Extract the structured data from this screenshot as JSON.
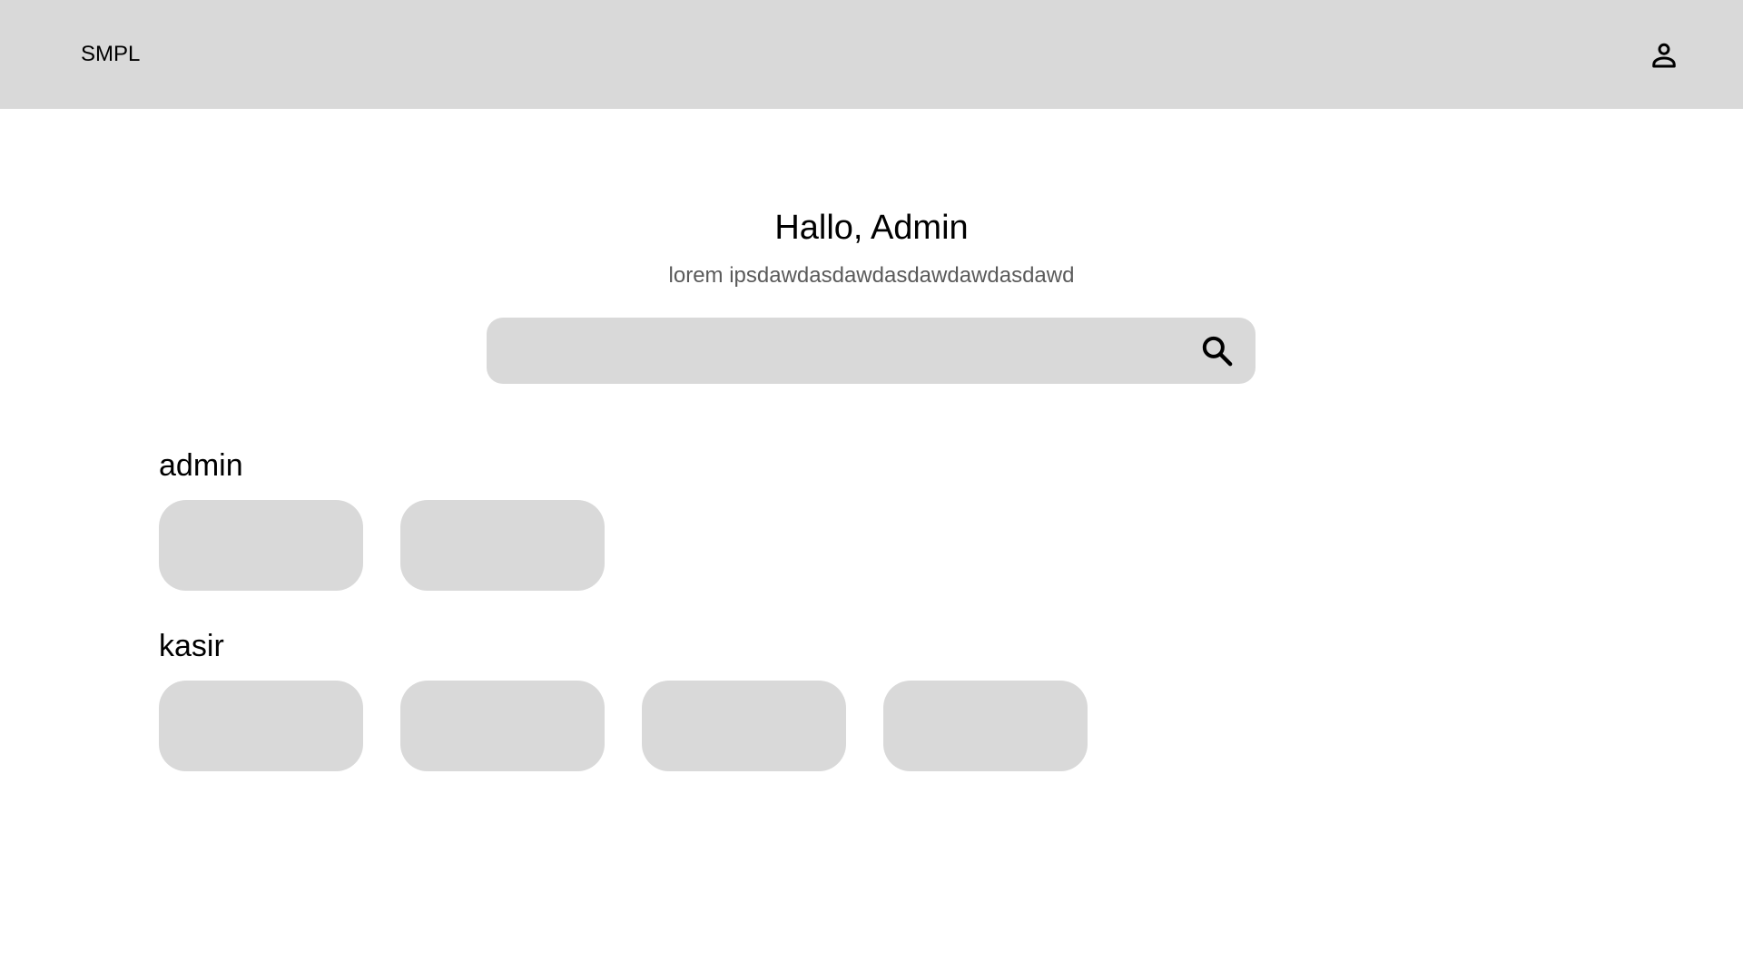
{
  "header": {
    "brand": "SMPL",
    "profile_icon": "person-icon"
  },
  "hero": {
    "greeting": "Hallo, Admin",
    "subtitle": "lorem ipsdawdasdawdasdawdawdasdawd"
  },
  "search": {
    "value": "",
    "placeholder": "",
    "icon": "search-icon"
  },
  "sections": [
    {
      "title": "admin",
      "card_count": 2
    },
    {
      "title": "kasir",
      "card_count": 4
    }
  ],
  "colors": {
    "surface": "#d9d9d9",
    "background": "#ffffff",
    "subtitle_text": "#5a5a5a"
  }
}
